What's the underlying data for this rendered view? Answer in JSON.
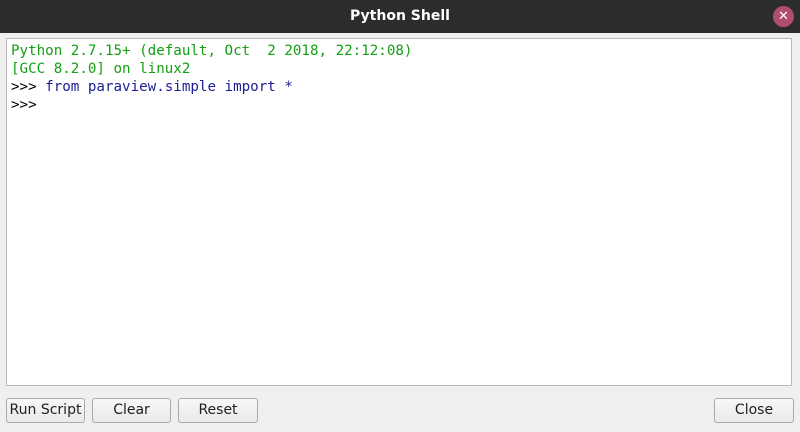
{
  "window": {
    "title": "Python Shell",
    "close_glyph": "✕"
  },
  "console": {
    "lines": [
      {
        "text": "Python 2.7.15+ (default, Oct  2 2018, 22:12:08)",
        "color": "#14a014"
      },
      {
        "text": "[GCC 8.2.0] on linux2",
        "color": "#14a014"
      },
      {
        "prompt": ">>> ",
        "code": "from paraview.simple import *"
      },
      {
        "prompt": ">>>",
        "code": ""
      }
    ]
  },
  "buttons": {
    "run_script": "Run Script",
    "clear": "Clear",
    "reset": "Reset",
    "close": "Close"
  },
  "colors": {
    "titlebar": "#2c2c2c",
    "close_button": "#b34d6e",
    "banner_text": "#14a014",
    "code_text": "#1c1c96"
  }
}
